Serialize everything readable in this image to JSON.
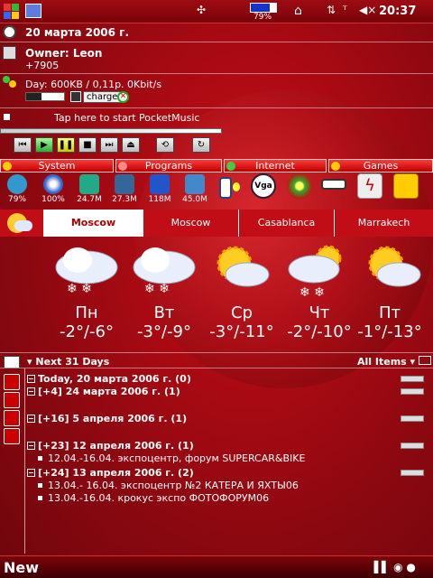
{
  "statusbar": {
    "battery_pct": "79%",
    "time": "20:37"
  },
  "date_line": "20 марта 2006 г.",
  "owner": {
    "name": "Owner: Leon",
    "phone": "+7905"
  },
  "traffic": {
    "line": "Day: 600KB / 0,11р.  0Kbit/s",
    "charge_label": "charge"
  },
  "music": {
    "label": "Tap here to start PocketMusic"
  },
  "tabs": [
    {
      "label": "System"
    },
    {
      "label": "Programs"
    },
    {
      "label": "Internet"
    },
    {
      "label": "Games"
    }
  ],
  "apps": [
    {
      "label": "79%"
    },
    {
      "label": "100%"
    },
    {
      "label": "24.7M"
    },
    {
      "label": "27.3M"
    },
    {
      "label": "118M"
    },
    {
      "label": "45.0M"
    }
  ],
  "cities": [
    {
      "label": "Moscow"
    },
    {
      "label": "Moscow"
    },
    {
      "label": "Casablanca"
    },
    {
      "label": "Marrakech"
    }
  ],
  "forecast": [
    {
      "day": "Пн",
      "temp": "-2°/-6°",
      "icon": "snow-cloud-icon"
    },
    {
      "day": "Вт",
      "temp": "-3°/-9°",
      "icon": "snow-cloud-icon"
    },
    {
      "day": "Ср",
      "temp": "-3°/-11°",
      "icon": "sun-cloud-icon"
    },
    {
      "day": "Чт",
      "temp": "-2°/-10°",
      "icon": "snow-sun-icon"
    },
    {
      "day": "Пт",
      "temp": "-1°/-13°",
      "icon": "sun-cloud-icon"
    }
  ],
  "agenda": {
    "header": "Next 31 Days",
    "filter": "All Items",
    "items": [
      {
        "title": "Today, 20 марта 2006 г. (0)"
      },
      {
        "title": "[+4] 24 марта 2006 г. (1)"
      },
      {
        "title": "[+16] 5 апреля 2006 г. (1)"
      },
      {
        "title": "[+23] 12 апреля 2006 г. (1)",
        "sub": [
          "12.04.-16.04. экспоцентр, форум SUPERCAR&BIKE"
        ]
      },
      {
        "title": "[+24] 13 апреля 2006 г. (2)",
        "sub": [
          "13.04.- 16.04. экспоцентр №2 КАТЕРА И ЯХТЫ06",
          "13.04.-16.04. крокус экспо ФОТОФОРУМ06"
        ]
      }
    ]
  },
  "bottombar": {
    "new_label": "New"
  }
}
